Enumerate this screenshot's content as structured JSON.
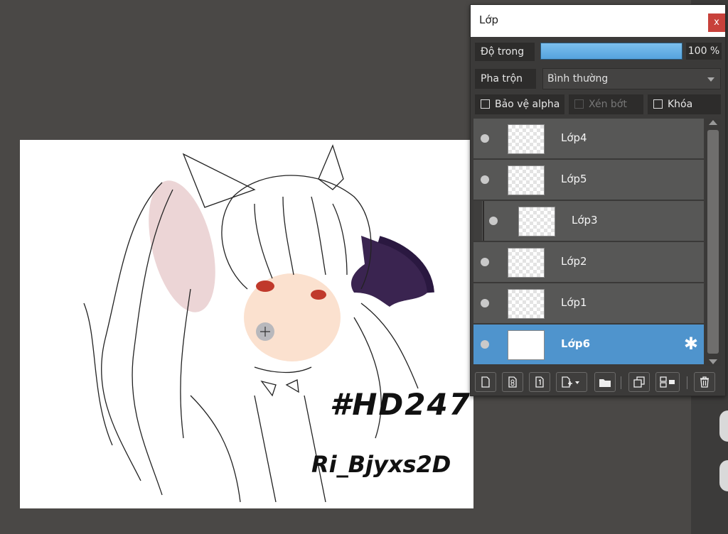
{
  "panel": {
    "title": "Lớp",
    "close_label": "x",
    "opacity_label": "Độ trong",
    "opacity_value": "100 %",
    "opacity_fraction": 1.0,
    "blend_label": "Pha trộn",
    "blend_value": "Bình thường",
    "checkboxes": {
      "protect_alpha": "Bảo vệ alpha",
      "clipping": "Xén bớt",
      "lock": "Khóa"
    }
  },
  "layers": [
    {
      "name": "Lớp4",
      "selected": false,
      "clipped": false
    },
    {
      "name": "Lớp5",
      "selected": false,
      "clipped": false
    },
    {
      "name": "Lớp3",
      "selected": false,
      "clipped": true
    },
    {
      "name": "Lớp2",
      "selected": false,
      "clipped": false
    },
    {
      "name": "Lớp1",
      "selected": false,
      "clipped": false
    },
    {
      "name": "Lớp6",
      "selected": true,
      "clipped": false
    }
  ],
  "toolbar_icons": [
    "new-layer-icon",
    "new-8bit-layer-icon",
    "new-1bit-layer-icon",
    "add-layer-dropdown-icon",
    "folder-icon",
    "duplicate-layer-icon",
    "merge-down-icon",
    "delete-layer-icon"
  ],
  "canvas_text": {
    "line1": "#HD247",
    "line2": "Ri_Bjyxs2D"
  },
  "colors": {
    "background": "#4a4846",
    "panel": "#3b3a39",
    "selected_layer": "#4f94cd",
    "opacity_bar": "#6ab3e8",
    "close_button": "#c8413b"
  }
}
